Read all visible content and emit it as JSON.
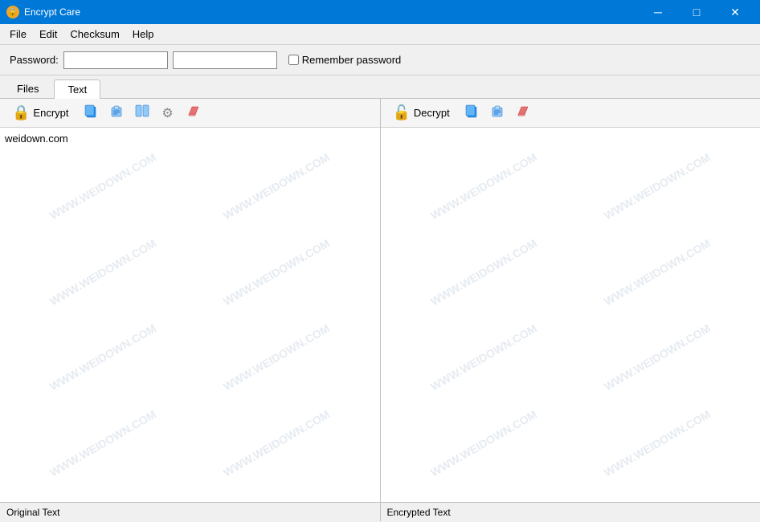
{
  "window": {
    "title": "Encrypt Care",
    "icon": "🔒"
  },
  "titlebar": {
    "minimize": "─",
    "maximize": "□",
    "close": "✕"
  },
  "menu": {
    "items": [
      "File",
      "Edit",
      "Checksum",
      "Help"
    ]
  },
  "password_bar": {
    "label": "Password:",
    "placeholder1": "",
    "placeholder2": "",
    "remember_label": "Remember password"
  },
  "tabs": [
    {
      "label": "Files",
      "active": false
    },
    {
      "label": "Text",
      "active": true
    }
  ],
  "left_panel": {
    "action_label": "Encrypt",
    "status_label": "Original Text",
    "watermark": "WWW.WEIDOWN.COM",
    "content": "weidown.com"
  },
  "right_panel": {
    "action_label": "Decrypt",
    "status_label": "Encrypted Text",
    "watermark": "WWW.WEIDOWN.COM",
    "content": ""
  },
  "toolbar": {
    "copy_icon": "📋",
    "paste_icon": "📄",
    "settings_icon": "⚙",
    "clear_icon": "✏",
    "columns_icon": "⊞"
  },
  "colors": {
    "accent": "#0078d7",
    "lock_color": "#f5a623"
  }
}
